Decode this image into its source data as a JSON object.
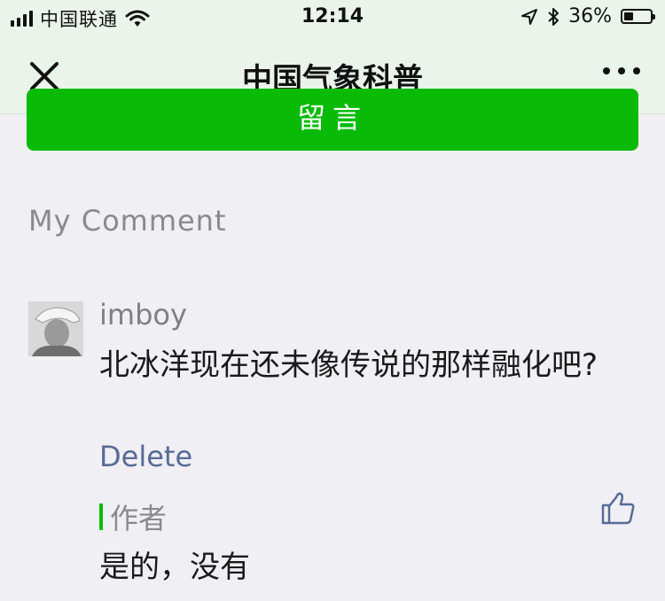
{
  "status_bar": {
    "carrier": "中国联通",
    "time": "12:14",
    "battery_text": "36%",
    "battery_level": 0.36,
    "icons": [
      "signal-icon",
      "wifi-icon",
      "location-arrow-icon",
      "bluetooth-icon",
      "battery-icon"
    ]
  },
  "nav": {
    "title": "中国气象科普",
    "close_icon": "close-icon",
    "more_icon": "more-icon"
  },
  "top_button": {
    "label": "留言"
  },
  "section": {
    "title": "My Comment"
  },
  "comment": {
    "nickname": "imboy",
    "text": "北冰洋现在还未像传说的那样融化吧?",
    "delete_label": "Delete",
    "reply_author_label": "作者",
    "reply_text": "是的，没有",
    "like_icon": "thumbs-up-icon"
  },
  "colors": {
    "accent_green": "#09bb07",
    "link_blue": "#576b95",
    "nav_background": "#eaf4ea",
    "page_background": "#efeff4"
  }
}
